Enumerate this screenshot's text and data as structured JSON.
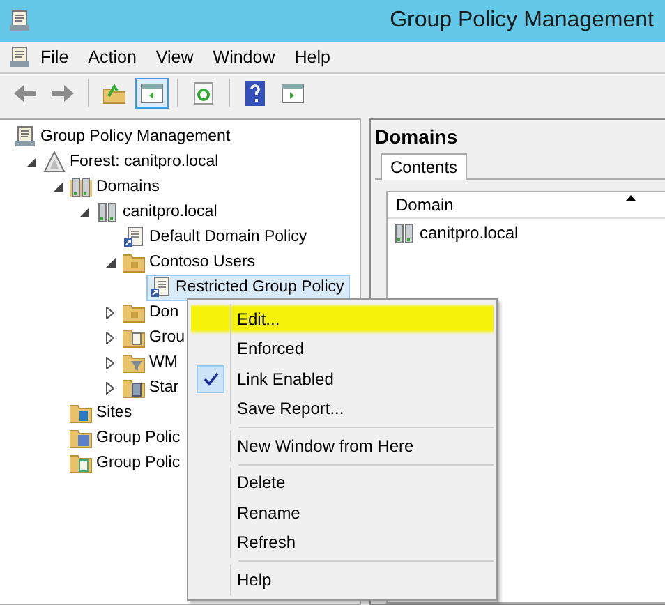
{
  "window": {
    "title": "Group Policy Management"
  },
  "menu_bar": [
    "File",
    "Action",
    "View",
    "Window",
    "Help"
  ],
  "toolbar": [
    {
      "kind": "back",
      "pressed": false
    },
    {
      "kind": "forward",
      "pressed": false
    },
    {
      "kind": "separator"
    },
    {
      "kind": "up",
      "pressed": false
    },
    {
      "kind": "tree",
      "pressed": true
    },
    {
      "kind": "separator"
    },
    {
      "kind": "export",
      "pressed": false
    },
    {
      "kind": "separator"
    },
    {
      "kind": "help",
      "pressed": false
    },
    {
      "kind": "pane",
      "pressed": false
    }
  ],
  "tree": [
    {
      "label": "Group Policy Management",
      "kind": "console",
      "selected": false,
      "children": [
        {
          "label": "Forest: canitpro.local",
          "kind": "forest",
          "expanded": true,
          "selected": false,
          "children": [
            {
              "label": "Domains",
              "kind": "domains",
              "expanded": true,
              "selected": false,
              "children": [
                {
                  "label": "canitpro.local",
                  "kind": "domain",
                  "expanded": true,
                  "selected": false,
                  "children": [
                    {
                      "label": "Default Domain Policy",
                      "kind": "link",
                      "selected": false
                    },
                    {
                      "label": "Contoso Users",
                      "kind": "ou",
                      "expanded": true,
                      "selected": false,
                      "children": [
                        {
                          "label": "Restricted Group Policy",
                          "kind": "link",
                          "selected": true
                        }
                      ]
                    },
                    {
                      "label": "Don",
                      "kind": "ou",
                      "expanded": false,
                      "selected": false
                    },
                    {
                      "label": "Grou",
                      "kind": "gpos",
                      "expanded": false,
                      "selected": false
                    },
                    {
                      "label": "WM",
                      "kind": "wmi",
                      "expanded": false,
                      "selected": false
                    },
                    {
                      "label": "Star",
                      "kind": "starter",
                      "expanded": false,
                      "selected": false
                    }
                  ]
                }
              ]
            },
            {
              "label": "Sites",
              "kind": "sites",
              "selected": false
            },
            {
              "label": "Group Polic",
              "kind": "modeling",
              "selected": false
            },
            {
              "label": "Group Polic",
              "kind": "results",
              "selected": false
            }
          ]
        }
      ]
    }
  ],
  "details": {
    "heading": "Domains",
    "tabs": [
      {
        "label": "Contents",
        "selected": true
      }
    ],
    "columns": [
      {
        "label": "Domain",
        "sort_ascending": true
      }
    ],
    "rows": [
      {
        "cells": [
          "canitpro.local"
        ]
      }
    ]
  },
  "context_menu": [
    {
      "kind": "item",
      "label": "Edit...",
      "checked": false,
      "highlighted": true
    },
    {
      "kind": "item",
      "label": "Enforced",
      "checked": false,
      "highlighted": false
    },
    {
      "kind": "item",
      "label": "Link Enabled",
      "checked": true,
      "highlighted": false
    },
    {
      "kind": "item",
      "label": "Save Report...",
      "checked": false,
      "highlighted": false
    },
    {
      "kind": "separator"
    },
    {
      "kind": "item",
      "label": "New Window from Here",
      "checked": false,
      "highlighted": false
    },
    {
      "kind": "separator"
    },
    {
      "kind": "item",
      "label": "Delete",
      "checked": false,
      "highlighted": false
    },
    {
      "kind": "item",
      "label": "Rename",
      "checked": false,
      "highlighted": false
    },
    {
      "kind": "item",
      "label": "Refresh",
      "checked": false,
      "highlighted": false
    },
    {
      "kind": "separator"
    },
    {
      "kind": "item",
      "label": "Help",
      "checked": false,
      "highlighted": false
    }
  ]
}
